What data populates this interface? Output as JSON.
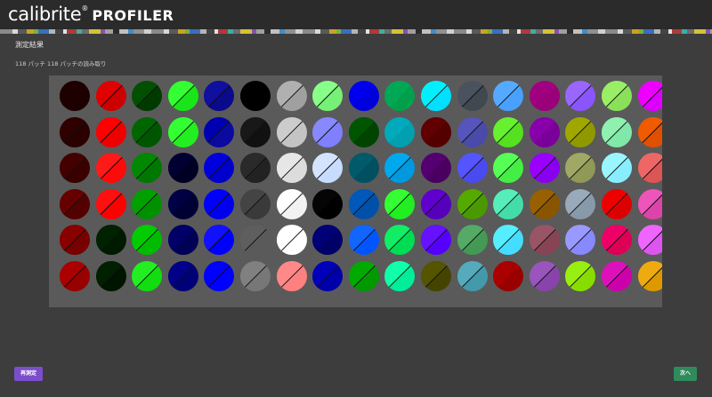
{
  "header": {
    "brand": "calibrite",
    "brand_mark": "®",
    "product": "PROFILER",
    "strip_colors": [
      "#8a8a8a",
      "#d8d8d8",
      "#5a5a5a",
      "#c9a227",
      "#7ab03a",
      "#3a6fbf",
      "#b5b5b5",
      "#444444",
      "#e0e0e0",
      "#b03a3a",
      "#3ab0a0",
      "#6d6d6d",
      "#d4c23a",
      "#8c4fb0",
      "#a0a0a0",
      "#2c2c2c",
      "#c0c0c0",
      "#3a8fd0",
      "#909090",
      "#d0d0d0"
    ]
  },
  "page": {
    "title": "測定結果",
    "subtitle": "118 パッチ 118 パッチの読み取り"
  },
  "patches": [
    [
      {
        "c": "#1f0000",
        "r": "#1f0000",
        "line": false
      },
      {
        "c": "#cc0000",
        "r": "#e00000",
        "line": true
      },
      {
        "c": "#003a00",
        "r": "#005000",
        "line": true
      },
      {
        "c": "#19e619",
        "r": "#33ff33",
        "line": true
      },
      {
        "c": "#0a0a8a",
        "r": "#0f0fa0",
        "line": true
      },
      {
        "c": "#000000",
        "r": "#000000",
        "line": false
      },
      {
        "c": "#a0a0a0",
        "r": "#b0b0b0",
        "line": true
      },
      {
        "c": "#77f077",
        "r": "#88ff88",
        "line": true
      },
      {
        "c": "#0000dd",
        "r": "#0000ee",
        "line": false
      },
      {
        "c": "#00a04a",
        "r": "#00a855",
        "line": false
      },
      {
        "c": "#00e0ff",
        "r": "#00f0ff",
        "line": true
      },
      {
        "c": "#404850",
        "r": "#4a5260",
        "line": true
      },
      {
        "c": "#4aa0ff",
        "r": "#55aaff",
        "line": true
      },
      {
        "c": "#99007a",
        "r": "#a00080",
        "line": false
      },
      {
        "c": "#8a55ff",
        "r": "#9966ff",
        "line": true
      },
      {
        "c": "#8ae05a",
        "r": "#99ee66",
        "line": true
      },
      {
        "c": "#dd00ff",
        "r": "#ee00ff",
        "line": true
      }
    ],
    [
      {
        "c": "#2a0000",
        "r": "#300000",
        "line": true
      },
      {
        "c": "#ee0000",
        "r": "#ff0000",
        "line": true
      },
      {
        "c": "#005500",
        "r": "#006600",
        "line": true
      },
      {
        "c": "#22ee22",
        "r": "#33ff33",
        "line": true
      },
      {
        "c": "#0a0aa0",
        "r": "#0000b0",
        "line": true
      },
      {
        "c": "#111111",
        "r": "#181818",
        "line": true
      },
      {
        "c": "#c4c4c4",
        "r": "#cccccc",
        "line": true
      },
      {
        "c": "#8080ff",
        "r": "#8888ff",
        "line": true
      },
      {
        "c": "#004400",
        "r": "#005500",
        "line": false
      },
      {
        "c": "#00a0b0",
        "r": "#00aabb",
        "line": false
      },
      {
        "c": "#550000",
        "r": "#600000",
        "line": false
      },
      {
        "c": "#4a4aa8",
        "r": "#5555bb",
        "line": true
      },
      {
        "c": "#55e020",
        "r": "#66f030",
        "line": true
      },
      {
        "c": "#7a0099",
        "r": "#8800aa",
        "line": false
      },
      {
        "c": "#909900",
        "r": "#a0a800",
        "line": true
      },
      {
        "c": "#80e8a8",
        "r": "#90f0b0",
        "line": true
      },
      {
        "c": "#e05000",
        "r": "#f05a00",
        "line": true
      }
    ],
    [
      {
        "c": "#3a0000",
        "r": "#440000",
        "line": true
      },
      {
        "c": "#ff0a0a",
        "r": "#ff1a1a",
        "line": true
      },
      {
        "c": "#007700",
        "r": "#008800",
        "line": true
      },
      {
        "c": "#000022",
        "r": "#000033",
        "line": false
      },
      {
        "c": "#0000cc",
        "r": "#0000dd",
        "line": true
      },
      {
        "c": "#222222",
        "r": "#2a2a2a",
        "line": true
      },
      {
        "c": "#dcdcdc",
        "r": "#e6e6e6",
        "line": true
      },
      {
        "c": "#c8dcff",
        "r": "#d4e4ff",
        "line": true
      },
      {
        "c": "#005060",
        "r": "#005a6a",
        "line": false
      },
      {
        "c": "#0099e0",
        "r": "#00a8ee",
        "line": true
      },
      {
        "c": "#4a0060",
        "r": "#550070",
        "line": false
      },
      {
        "c": "#4a4af0",
        "r": "#5555ff",
        "line": true
      },
      {
        "c": "#44ee44",
        "r": "#55ff55",
        "line": true
      },
      {
        "c": "#8800ee",
        "r": "#9900ff",
        "line": true
      },
      {
        "c": "#909955",
        "r": "#a0a866",
        "line": true
      },
      {
        "c": "#88eeff",
        "r": "#99f5ff",
        "line": true
      },
      {
        "c": "#dd5555",
        "r": "#ee6666",
        "line": true
      }
    ],
    [
      {
        "c": "#550000",
        "r": "#660000",
        "line": true
      },
      {
        "c": "#ff0000",
        "r": "#ff1010",
        "line": true
      },
      {
        "c": "#009000",
        "r": "#00a000",
        "line": true
      },
      {
        "c": "#000033",
        "r": "#000044",
        "line": false
      },
      {
        "c": "#0000ee",
        "r": "#0000ff",
        "line": true
      },
      {
        "c": "#3a3a3a",
        "r": "#444444",
        "line": true
      },
      {
        "c": "#f2f2f2",
        "r": "#ffffff",
        "line": true
      },
      {
        "c": "#000000",
        "r": "#050505",
        "line": false
      },
      {
        "c": "#0050aa",
        "r": "#0058bb",
        "line": true
      },
      {
        "c": "#22ee22",
        "r": "#33ff33",
        "line": true
      },
      {
        "c": "#5500bb",
        "r": "#6000cc",
        "line": true
      },
      {
        "c": "#4a9900",
        "r": "#55aa00",
        "line": true
      },
      {
        "c": "#44ddaa",
        "r": "#55eebb",
        "line": true
      },
      {
        "c": "#8a5500",
        "r": "#996000",
        "line": true
      },
      {
        "c": "#8899aa",
        "r": "#99aabb",
        "line": true
      },
      {
        "c": "#dd0000",
        "r": "#ee0000",
        "line": true
      },
      {
        "c": "#dd44aa",
        "r": "#ee55bb",
        "line": true
      }
    ],
    [
      {
        "c": "#770000",
        "r": "#880000",
        "line": true
      },
      {
        "c": "#001a00",
        "r": "#002200",
        "line": false
      },
      {
        "c": "#00bb00",
        "r": "#00cc00",
        "line": true
      },
      {
        "c": "#000055",
        "r": "#000066",
        "line": false
      },
      {
        "c": "#0000ff",
        "r": "#1111ff",
        "line": true
      },
      {
        "c": "#5a5a5a",
        "r": "#5e5e5e",
        "line": true
      },
      {
        "c": "#ffffff",
        "r": "#ffffff",
        "line": true
      },
      {
        "c": "#000066",
        "r": "#000077",
        "line": false
      },
      {
        "c": "#0055ff",
        "r": "#1166ff",
        "line": true
      },
      {
        "c": "#00dd55",
        "r": "#11ee66",
        "line": true
      },
      {
        "c": "#5500ff",
        "r": "#6611ff",
        "line": true
      },
      {
        "c": "#449955",
        "r": "#55aa66",
        "line": true
      },
      {
        "c": "#44ddff",
        "r": "#55eeff",
        "line": true
      },
      {
        "c": "#884455",
        "r": "#995566",
        "line": true
      },
      {
        "c": "#8888ff",
        "r": "#9999ff",
        "line": true
      },
      {
        "c": "#dd0055",
        "r": "#ee0066",
        "line": true
      },
      {
        "c": "#dd55ee",
        "r": "#ee66ff",
        "line": true
      }
    ],
    [
      {
        "c": "#990000",
        "r": "#aa0000",
        "line": true
      },
      {
        "c": "#001500",
        "r": "#002000",
        "line": true
      },
      {
        "c": "#11dd11",
        "r": "#22ee22",
        "line": true
      },
      {
        "c": "#000077",
        "r": "#000088",
        "line": true
      },
      {
        "c": "#0000ff",
        "r": "#0000ff",
        "line": true
      },
      {
        "c": "#777777",
        "r": "#808080",
        "line": true
      },
      {
        "c": "#ff8080",
        "r": "#ff8888",
        "line": true
      },
      {
        "c": "#0000aa",
        "r": "#0000bb",
        "line": true
      },
      {
        "c": "#009900",
        "r": "#00aa00",
        "line": true
      },
      {
        "c": "#00ee99",
        "r": "#11ffaa",
        "line": true
      },
      {
        "c": "#444400",
        "r": "#555500",
        "line": true
      },
      {
        "c": "#4499aa",
        "r": "#55aabb",
        "line": true
      },
      {
        "c": "#990000",
        "r": "#aa0000",
        "line": false
      },
      {
        "c": "#8844aa",
        "r": "#9955bb",
        "line": true
      },
      {
        "c": "#88dd00",
        "r": "#99ee11",
        "line": true
      },
      {
        "c": "#cc00aa",
        "r": "#dd11bb",
        "line": true
      },
      {
        "c": "#dd9900",
        "r": "#eeaa11",
        "line": true
      }
    ]
  ],
  "actions": {
    "remeasure_label": "再測定",
    "next_label": "次へ"
  }
}
